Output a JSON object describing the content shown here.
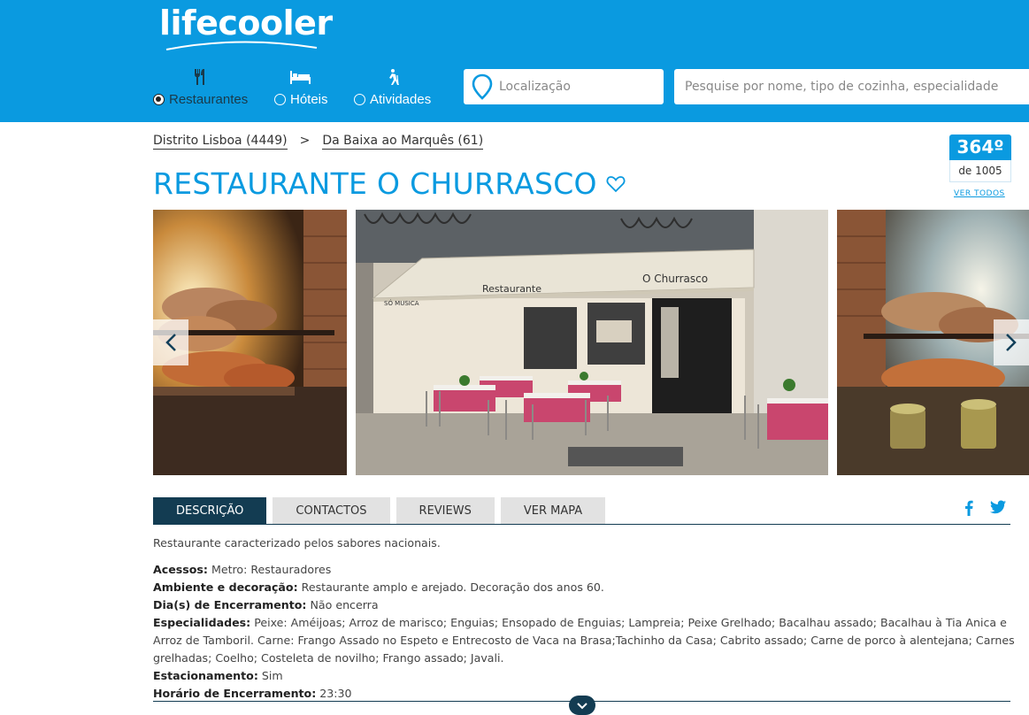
{
  "header": {
    "logo": "lifecooler",
    "categories": [
      {
        "label": "Restaurantes",
        "selected": true,
        "icon": "fork-knife-icon"
      },
      {
        "label": "Hóteis",
        "selected": false,
        "icon": "bed-icon"
      },
      {
        "label": "Atividades",
        "selected": false,
        "icon": "hiker-icon"
      }
    ],
    "location_placeholder": "Localização",
    "search_placeholder": "Pesquise por nome, tipo de cozinha, especialidade"
  },
  "breadcrumb": {
    "items": [
      "Distrito Lisboa (4449)",
      "Da Baixa ao Marquês (61)"
    ],
    "separator": ">"
  },
  "page_title": "RESTAURANTE O CHURRASCO",
  "ranking": {
    "position": "364º",
    "total": "de 1005",
    "link": "VER TODOS"
  },
  "gallery": {
    "storefront_sign_left": "Restaurante",
    "storefront_sign_right": "O Churrasco",
    "awning_small": "SÓ MUSICA"
  },
  "tabs": [
    {
      "label": "DESCRIÇÃO",
      "active": true
    },
    {
      "label": "CONTACTOS",
      "active": false
    },
    {
      "label": "REVIEWS",
      "active": false
    },
    {
      "label": "VER MAPA",
      "active": false
    }
  ],
  "description": {
    "intro": "Restaurante caracterizado pelos sabores nacionais.",
    "fields": [
      {
        "label": "Acessos",
        "value": "Metro: Restauradores"
      },
      {
        "label": "Ambiente e decoração",
        "value": "Restaurante amplo e arejado. Decoração dos anos 60."
      },
      {
        "label": "Dia(s) de Encerramento",
        "value": "Não encerra"
      },
      {
        "label": "Especialidades",
        "value": "Peixe: Améijoas; Arroz de marisco; Enguias; Ensopado de Enguias; Lampreia; Peixe Grelhado; Bacalhau assado; Bacalhau à Tia Anica e Arroz de Tamboril. Carne: Frango Assado no Espeto e Entrecosto de Vaca na Brasa;Tachinho da Casa; Cabrito assado; Carne de porco à alentejana; Carnes grelhadas; Coelho; Costeleta de novilho; Frango assado; Javali."
      },
      {
        "label": "Estacionamento",
        "value": "Sim"
      },
      {
        "label": "Horário de Encerramento",
        "value": "23:30"
      }
    ]
  },
  "colors": {
    "brand": "#0a9ae0",
    "dark": "#133c52"
  }
}
